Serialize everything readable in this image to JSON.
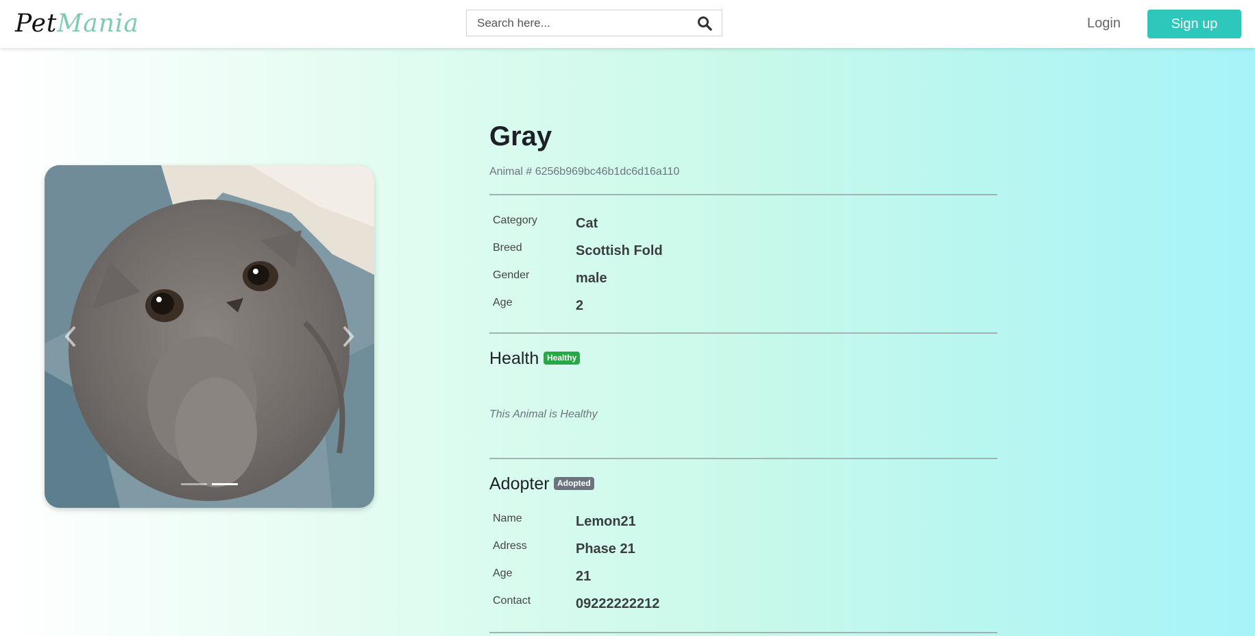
{
  "navbar": {
    "logo_part1": "Pet",
    "logo_part2": "Mania",
    "search_placeholder": "Search here...",
    "search_icon": "search-icon",
    "login_label": "Login",
    "signup_label": "Sign up"
  },
  "carousel": {
    "prev_icon": "chevron-left-icon",
    "next_icon": "chevron-right-icon",
    "slides": 2,
    "active_slide": 2
  },
  "animal": {
    "name": "Gray",
    "id_text": "Animal # 6256b969bc46b1dc6d16a110",
    "info": [
      {
        "label": "Category",
        "value": "Cat"
      },
      {
        "label": "Breed",
        "value": "Scottish Fold"
      },
      {
        "label": "Gender",
        "value": "male"
      },
      {
        "label": "Age",
        "value": "2"
      }
    ]
  },
  "health": {
    "title": "Health",
    "badge": "Healthy",
    "note": "This Animal is Healthy"
  },
  "adopter": {
    "title": "Adopter",
    "badge": "Adopted",
    "info": [
      {
        "label": "Name",
        "value": "Lemon21"
      },
      {
        "label": "Adress",
        "value": "Phase 21"
      },
      {
        "label": "Age",
        "value": "21"
      },
      {
        "label": "Contact",
        "value": "09222222212"
      }
    ]
  },
  "colors": {
    "brand_teal": "#2ec7bc",
    "logo_mania": "#7fcbb0",
    "healthy_badge": "#28a745",
    "adopted_badge": "#6c757d"
  }
}
